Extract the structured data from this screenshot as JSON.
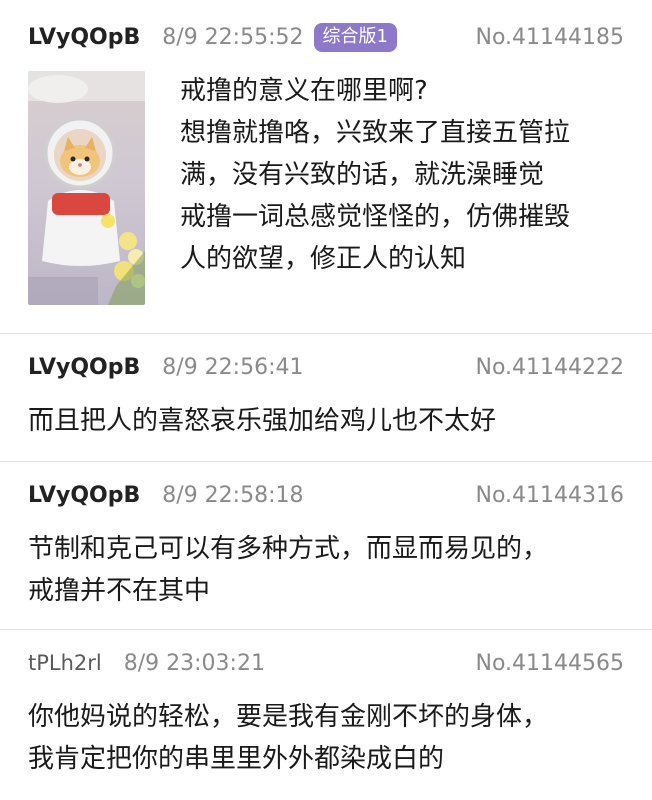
{
  "posts": [
    {
      "uid": "LVyQOpB",
      "time": "8/9 22:55:52",
      "badge": "综合版1",
      "no": "No.41144185",
      "lines": [
        "戒撸的意义在哪里啊?",
        "想撸就撸咯，兴致来了直接五管拉",
        "满，没有兴致的话，就洗澡睡觉",
        "戒撸一词总感觉怪怪的，仿佛摧毁",
        "人的欲望，修正人的认知"
      ]
    },
    {
      "uid": "LVyQOpB",
      "time": "8/9 22:56:41",
      "no": "No.41144222",
      "lines": [
        "而且把人的喜怒哀乐强加给鸡儿也不太好"
      ]
    },
    {
      "uid": "LVyQOpB",
      "time": "8/9 22:58:18",
      "no": "No.41144316",
      "lines": [
        "节制和克己可以有多种方式，而显而易见的，",
        "戒撸并不在其中"
      ]
    },
    {
      "uid": "tPLh2rl",
      "time": "8/9 23:03:21",
      "no": "No.41144565",
      "lines": [
        "你他妈说的轻松，要是我有金刚不坏的身体，",
        "我肯定把你的串里里外外都染成白的"
      ]
    }
  ],
  "colors": {
    "badge": "#8e78c9",
    "meta": "#8a8a8a",
    "divider": "#e2e2e2"
  },
  "thumbnail_icon": "astronaut-cat-photo"
}
